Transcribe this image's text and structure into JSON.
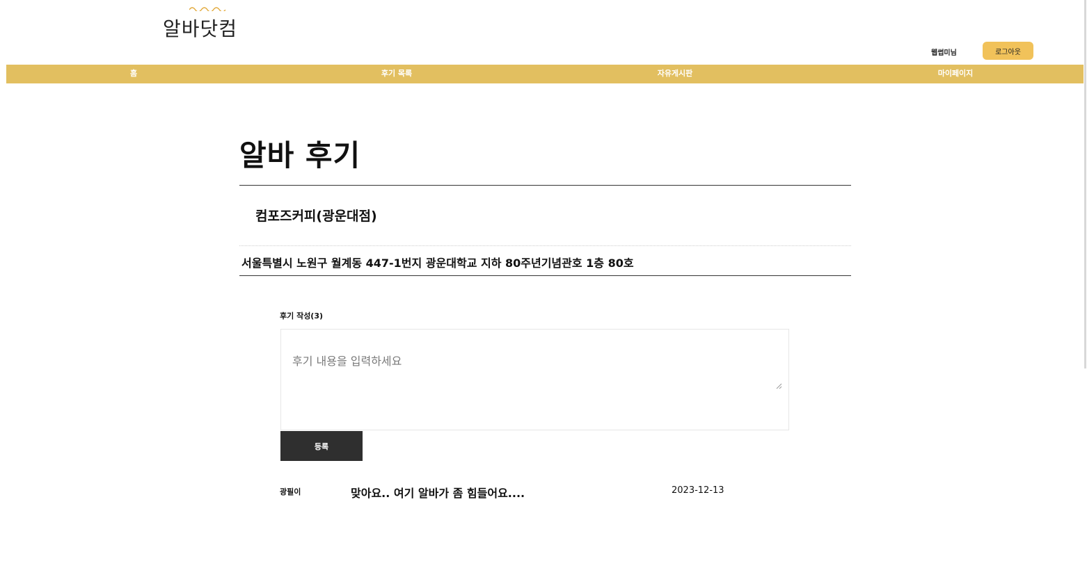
{
  "header": {
    "logo_text": "알바닷컴",
    "user_name": "웹썹미님",
    "logout_label": "로그아웃"
  },
  "nav": {
    "items": [
      {
        "label": "홈"
      },
      {
        "label": "후기 목록"
      },
      {
        "label": "자유게시판"
      },
      {
        "label": "마이페이지"
      }
    ]
  },
  "colors": {
    "nav_bar": "#e2bf60",
    "logout_button": "#f1c25a",
    "submit_button": "#2f2f2f"
  },
  "main": {
    "title": "알바 후기",
    "store_name": "컴포즈커피(광운대점)",
    "store_address": "서울특별시 노원구 월계동 447-1번지 광운대학교 지하 80주년기념관호 1층 80호",
    "review_form": {
      "count_label": "후기 작성(3)",
      "placeholder": "후기 내용을 입력하세요",
      "value": "",
      "submit_label": "등록"
    },
    "reviews": [
      {
        "author": "광필이",
        "content": "맞아요.. 여기 알바가 좀 힘들어요....",
        "date": "2023-12-13"
      }
    ]
  }
}
